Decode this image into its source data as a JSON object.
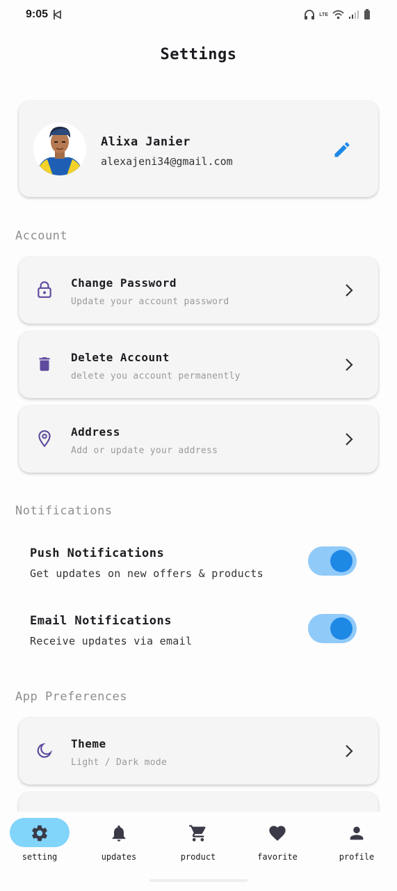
{
  "status_bar": {
    "time": "9:05",
    "network_label": "LTE"
  },
  "page": {
    "title": "Settings"
  },
  "profile": {
    "name": "Alixa Janier",
    "email": "alexajeni34@gmail.com"
  },
  "sections": {
    "account": "Account",
    "notifications": "Notifications",
    "preferences": "App Preferences"
  },
  "account_items": [
    {
      "title": "Change Password",
      "subtitle": "Update your account password",
      "icon": "lock-icon"
    },
    {
      "title": "Delete Account",
      "subtitle": "delete you account permanently",
      "icon": "trash-icon"
    },
    {
      "title": "Address",
      "subtitle": "Add or update your address",
      "icon": "location-pin-icon"
    }
  ],
  "notification_items": [
    {
      "title": "Push Notifications",
      "subtitle": "Get updates on new offers & products",
      "enabled": true
    },
    {
      "title": "Email Notifications",
      "subtitle": "Receive updates via email",
      "enabled": true
    }
  ],
  "preference_items": [
    {
      "title": "Theme",
      "subtitle": "Light / Dark mode",
      "icon": "moon-icon"
    }
  ],
  "bottom_nav": [
    {
      "label": "setting",
      "icon": "gear-icon",
      "active": true
    },
    {
      "label": "updates",
      "icon": "bell-icon",
      "active": false
    },
    {
      "label": "product",
      "icon": "cart-icon",
      "active": false
    },
    {
      "label": "favorite",
      "icon": "heart-icon",
      "active": false
    },
    {
      "label": "profile",
      "icon": "person-icon",
      "active": false
    }
  ],
  "colors": {
    "accent": "#1e88e5",
    "icon_purple": "#5e4a9e",
    "toggle_track": "#90caf9",
    "nav_active": "#81d4fa",
    "card_bg": "#f5f5f5",
    "section_label": "#8e8e8e"
  }
}
